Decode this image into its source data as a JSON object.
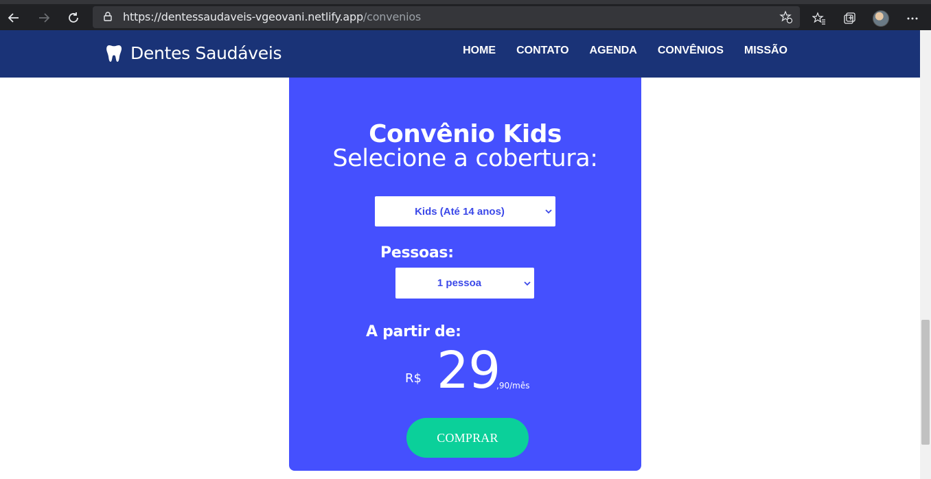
{
  "browser": {
    "url_host": "https://dentessaudaveis-vgeovani.netlify.app",
    "url_path": "/convenios",
    "icons": [
      "back-icon",
      "forward-icon",
      "reload-icon",
      "lock-icon",
      "add-favorite-icon",
      "favorites-icon",
      "collections-icon",
      "profile-avatar",
      "more-icon"
    ]
  },
  "header": {
    "brand": "Dentes Saudáveis",
    "menu": [
      "HOME",
      "CONTATO",
      "AGENDA",
      "CONVÊNIOS",
      "MISSÃO"
    ]
  },
  "card": {
    "title": "Convênio Kids",
    "subtitle": "Selecione a cobertura:",
    "plan_select": "Kids (Até 14 anos)",
    "people_label": "Pessoas:",
    "people_select": "1 pessoa",
    "price_label": "A partir de:",
    "currency": "R$",
    "price_int": "29",
    "price_cents": ",90/mês",
    "buy_button": "COMPRAR"
  },
  "colors": {
    "header_bg": "#1a3377",
    "card_bg": "#4550fe",
    "button_bg": "#0bd09a",
    "select_text": "#3b48e8"
  }
}
